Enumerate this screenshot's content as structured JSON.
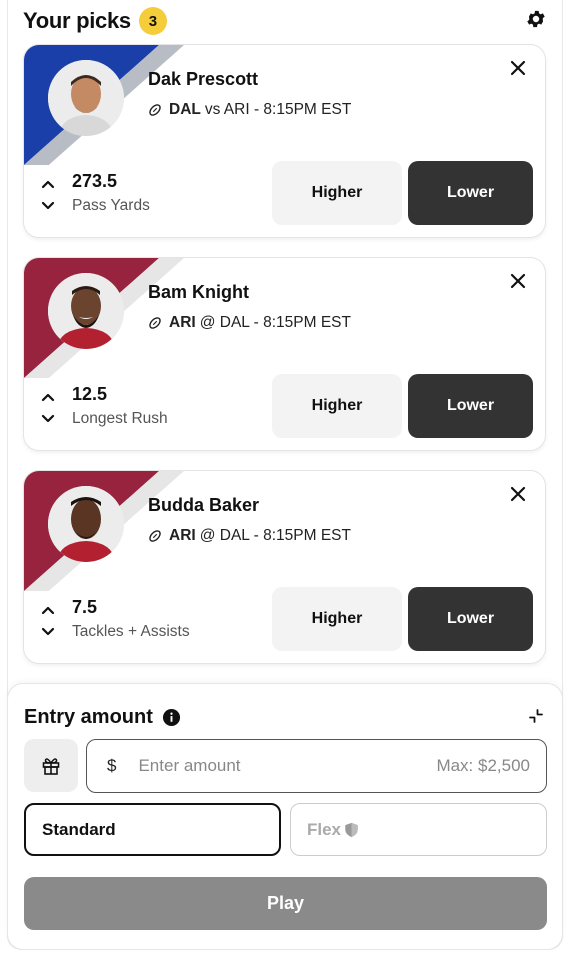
{
  "header": {
    "title": "Your picks",
    "count": "3"
  },
  "colors": {
    "badge": "#f5cd3b",
    "lower_btn": "#333333",
    "higher_btn": "#f3f3f3",
    "play_disabled": "#8a8a8a"
  },
  "picks": [
    {
      "name": "Dak Prescott",
      "team": "DAL",
      "matchup_rest": "vs ARI - 8:15PM EST",
      "line": "273.5",
      "stat": "Pass Yards",
      "higher_label": "Higher",
      "lower_label": "Lower",
      "stripe_color": "#1a3fa8",
      "stripe_accent": "#b8bcc4"
    },
    {
      "name": "Bam Knight",
      "team": "ARI",
      "matchup_rest": "@ DAL - 8:15PM EST",
      "line": "12.5",
      "stat": "Longest Rush",
      "higher_label": "Higher",
      "lower_label": "Lower",
      "stripe_color": "#97233f",
      "stripe_accent": "#e6e6e6"
    },
    {
      "name": "Budda Baker",
      "team": "ARI",
      "matchup_rest": "@ DAL - 8:15PM EST",
      "line": "7.5",
      "stat": "Tackles + Assists",
      "higher_label": "Higher",
      "lower_label": "Lower",
      "stripe_color": "#97233f",
      "stripe_accent": "#e6e6e6"
    }
  ],
  "entry": {
    "title": "Entry amount",
    "currency": "$",
    "placeholder": "Enter amount",
    "max": "Max: $2,500",
    "standard_label": "Standard",
    "flex_label": "Flex",
    "play_label": "Play"
  }
}
